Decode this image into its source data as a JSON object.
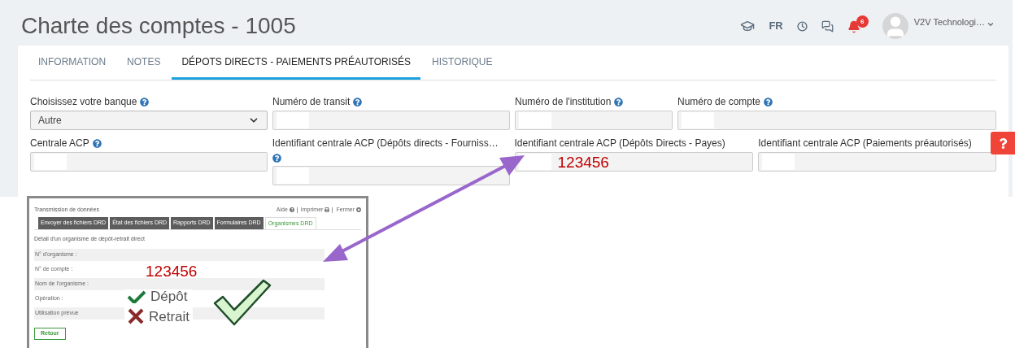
{
  "header": {
    "title": "Charte des comptes - 1005",
    "language": "FR",
    "notification_count": "6",
    "user": "V2V Technologi…"
  },
  "tabs": [
    {
      "label": "INFORMATION",
      "selected": false
    },
    {
      "label": "NOTES",
      "selected": false
    },
    {
      "label": "DÉPOTS DIRECTS - PAIEMENTS PRÉAUTORISÉS",
      "selected": true
    },
    {
      "label": "HISTORIQUE",
      "selected": false
    }
  ],
  "form_rows": [
    [
      {
        "label": "Choisissez votre banque",
        "help": true,
        "kind": "select",
        "value": "Autre"
      },
      {
        "label": "Numéro de transit",
        "help": true,
        "kind": "text",
        "redacted": true
      },
      {
        "label": "Numéro de l'institution",
        "help": true,
        "kind": "text",
        "redacted": true
      },
      {
        "label": "Numéro de compte",
        "help": true,
        "kind": "text",
        "redacted": true
      }
    ],
    [
      {
        "label": "Centrale ACP",
        "help": true,
        "kind": "text",
        "redacted": true
      },
      {
        "label": "Identifiant centrale ACP (Dépôts directs - Fourniss…",
        "help": true,
        "help_below": true,
        "kind": "text",
        "redacted": true
      },
      {
        "label": "Identifiant centrale ACP (Dépôts Directs - Payes)",
        "help": false,
        "kind": "text",
        "redacted": true,
        "value": "123456"
      },
      {
        "label": "Identifiant centrale ACP (Paiements préautorisés)",
        "help": false,
        "kind": "text",
        "redacted": true
      }
    ]
  ],
  "inset": {
    "title": "Transmission de données",
    "links": [
      "Aide",
      "Imprimer",
      "Fermer"
    ],
    "tabs": [
      {
        "label": "Envoyer des fichiers DRD",
        "selected": false
      },
      {
        "label": "État des fichiers DRD",
        "selected": false
      },
      {
        "label": "Rapports DRD",
        "selected": false
      },
      {
        "label": "Formulaires DRD",
        "selected": false
      },
      {
        "label": "Organismes DRD",
        "selected": true
      }
    ],
    "heading": "Détail d'un organisme de dépôt-retrait direct",
    "rows": [
      {
        "label": "N° d'organisme :",
        "shaded": true
      },
      {
        "label": "N° de compte :",
        "shaded": false
      },
      {
        "label": "Nom de l'organisme :",
        "shaded": true
      },
      {
        "label": "Opération :",
        "shaded": false
      },
      {
        "label": "Utilisation prévue",
        "shaded": true
      }
    ],
    "button": "Retour",
    "annotation_number": "123456",
    "options": [
      {
        "label": "Dépôt",
        "kind": "check"
      },
      {
        "label": "Retrait",
        "kind": "cross"
      }
    ]
  }
}
